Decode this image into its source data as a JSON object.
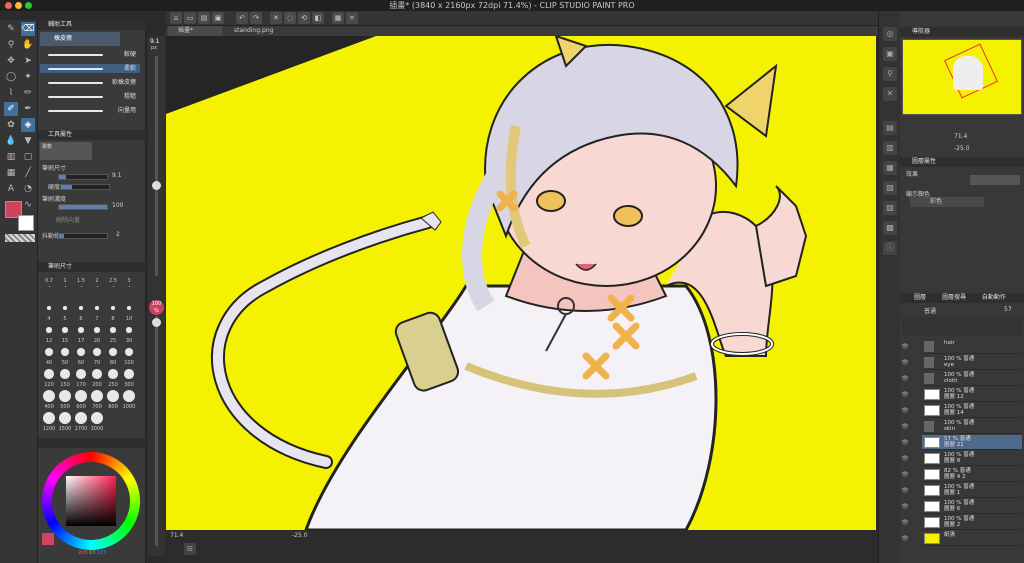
{
  "window": {
    "title": "插畫* (3840 x 2160px 72dpi 71.4%)  - CLIP STUDIO PAINT PRO"
  },
  "tabs": [
    {
      "label": "插畫*"
    },
    {
      "label": "standing.png"
    }
  ],
  "subtool": {
    "header": "輔助工具",
    "group": "橡皮擦",
    "brushes": [
      {
        "label": "較硬"
      },
      {
        "label": "柔軟"
      },
      {
        "label": "軟橡皮擦"
      },
      {
        "label": "粗糙"
      },
      {
        "label": "向量用"
      }
    ]
  },
  "toolprops": {
    "header": "工具屬性",
    "preview_label": "柔軟",
    "size_label": "筆刷尺寸",
    "size_value": "9.1",
    "hardness_label": "硬度",
    "density_label": "筆刷濃度",
    "density_value": "100",
    "vector_label": "刪除向量",
    "stabil_label": "抖動修正",
    "stabil_value": "2"
  },
  "brushsize": {
    "header": "筆刷尺寸",
    "sizes": [
      "0.7",
      "1",
      "1.5",
      "2",
      "2.5",
      "3",
      "4",
      "5",
      "6",
      "7",
      "8",
      "10",
      "12",
      "15",
      "17",
      "20",
      "25",
      "30",
      "40",
      "50",
      "60",
      "70",
      "80",
      "100",
      "120",
      "150",
      "170",
      "200",
      "250",
      "300",
      "400",
      "500",
      "600",
      "700",
      "800",
      "1000",
      "1200",
      "1500",
      "1700",
      "2000"
    ]
  },
  "sizebar": {
    "value": "9.1",
    "unit": "px",
    "opacity": "100",
    "opacity_unit": "%"
  },
  "color": {
    "primary": "#ce4460",
    "secondary": "#ffffff",
    "r": "206",
    "g": "63",
    "b": "103"
  },
  "canvas": {
    "bg": "#f4f200",
    "zoom": "71.4",
    "angle": "-25.0"
  },
  "navigator": {
    "header": "導航器",
    "zoom": "71.4",
    "angle": "-25.0"
  },
  "layerprop": {
    "header": "圖層屬性",
    "effect_label": "效果",
    "display_color_label": "顯示顏色",
    "color_mode": "彩色"
  },
  "layers": {
    "tabs": [
      "圖層",
      "圖層搜尋",
      "自動動作"
    ],
    "blend": "普通",
    "opacity": "57",
    "items": [
      {
        "name": "hair",
        "sub": ""
      },
      {
        "name": "100 % 普通",
        "sub": "eye"
      },
      {
        "name": "100 % 普通",
        "sub": "cloth"
      },
      {
        "name": "100 % 普通",
        "sub": "圖層 12"
      },
      {
        "name": "100 % 普通",
        "sub": "圖層 14"
      },
      {
        "name": "100 % 普通",
        "sub": "skin"
      },
      {
        "name": "57 % 普通",
        "sub": "圖層 21"
      },
      {
        "name": "100 % 普通",
        "sub": "圖層 8"
      },
      {
        "name": "82 % 普通",
        "sub": "圖層 4 2"
      },
      {
        "name": "100 % 普通",
        "sub": "圖層 1"
      },
      {
        "name": "100 % 普通",
        "sub": "圖層 6"
      },
      {
        "name": "100 % 普通",
        "sub": "圖層 2"
      },
      {
        "name": "",
        "sub": "紙張"
      }
    ]
  }
}
